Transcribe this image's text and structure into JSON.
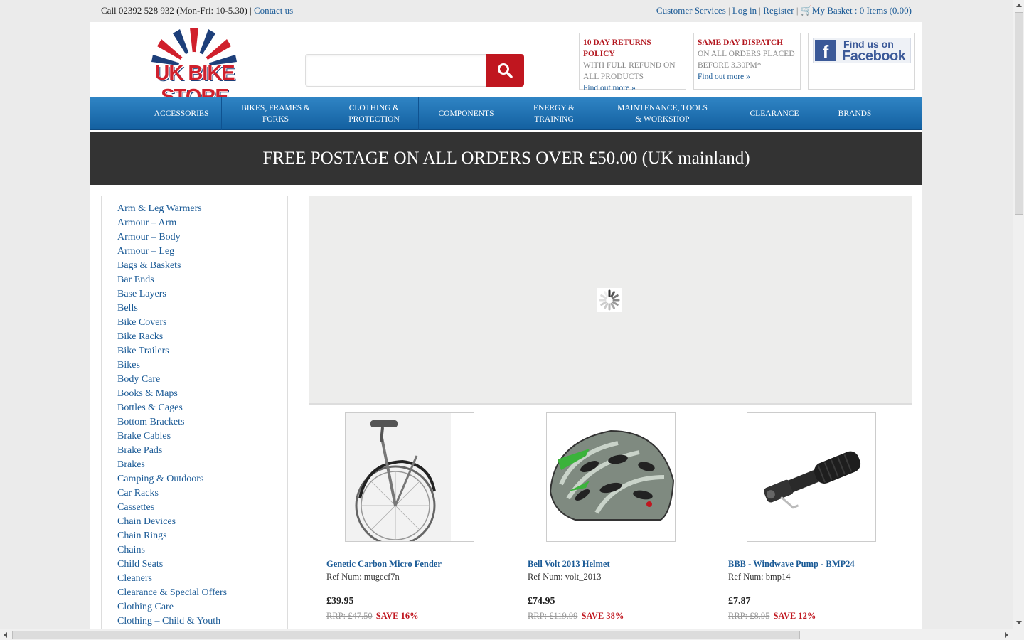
{
  "topbar": {
    "phone": "Call 02392 528 932 (Mon-Fri: 10-5.30)",
    "separator": "|",
    "contact": "Contact us",
    "customer_services": "Customer Services",
    "login": "Log in",
    "register": "Register",
    "basket": "My Basket : 0 Items (0.00)"
  },
  "logo": {
    "text": "UK BIKE STORE"
  },
  "search": {
    "placeholder": ""
  },
  "promos": [
    {
      "title": "10 DAY RETURNS POLICY",
      "body": "WITH FULL REFUND ON ALL PRODUCTS",
      "link": "Find out more »"
    },
    {
      "title": "SAME DAY DISPATCH",
      "body": "ON ALL ORDERS PLACED BEFORE 3.30PM*",
      "link": "Find out more »"
    }
  ],
  "facebook": {
    "line1": "Find us on",
    "line2": "Facebook"
  },
  "nav": [
    {
      "label": "ACCESSORIES"
    },
    {
      "label": "BIKES, FRAMES & FORKS"
    },
    {
      "label": "CLOTHING & PROTECTION"
    },
    {
      "label": "COMPONENTS"
    },
    {
      "label": "ENERGY & TRAINING"
    },
    {
      "label": "MAINTENANCE, TOOLS & WORKSHOP"
    },
    {
      "label": "CLEARANCE"
    },
    {
      "label": "BRANDS"
    }
  ],
  "banner": "FREE POSTAGE ON ALL ORDERS OVER £50.00 (UK mainland)",
  "sidebar": [
    "Arm & Leg Warmers",
    "Armour – Arm",
    "Armour – Body",
    "Armour – Leg",
    "Bags & Baskets",
    "Bar Ends",
    "Base Layers",
    "Bells",
    "Bike Covers",
    "Bike Racks",
    "Bike Trailers",
    "Bikes",
    "Body Care",
    "Books & Maps",
    "Bottles & Cages",
    "Bottom Brackets",
    "Brake Cables",
    "Brake Pads",
    "Brakes",
    "Camping & Outdoors",
    "Car Racks",
    "Cassettes",
    "Chain Devices",
    "Chain Rings",
    "Chains",
    "Child Seats",
    "Cleaners",
    "Clearance & Special Offers",
    "Clothing Care",
    "Clothing – Child & Youth"
  ],
  "products": [
    {
      "name": "Genetic Carbon Micro Fender",
      "ref": "Ref Num: mugecf7n",
      "price": "£39.95",
      "rrp": "RRP: £47.50",
      "save": "SAVE 16%",
      "image": "fender-icon"
    },
    {
      "name": "Bell Volt 2013 Helmet",
      "ref": "Ref Num: volt_2013",
      "price": "£74.95",
      "rrp": "RRP: £119.99",
      "save": "SAVE 38%",
      "image": "helmet-icon"
    },
    {
      "name": "BBB - Windwave Pump - BMP24",
      "ref": "Ref Num: bmp14",
      "price": "£7.87",
      "rrp": "RRP: £8.95",
      "save": "SAVE 12%",
      "image": "pump-icon"
    }
  ]
}
